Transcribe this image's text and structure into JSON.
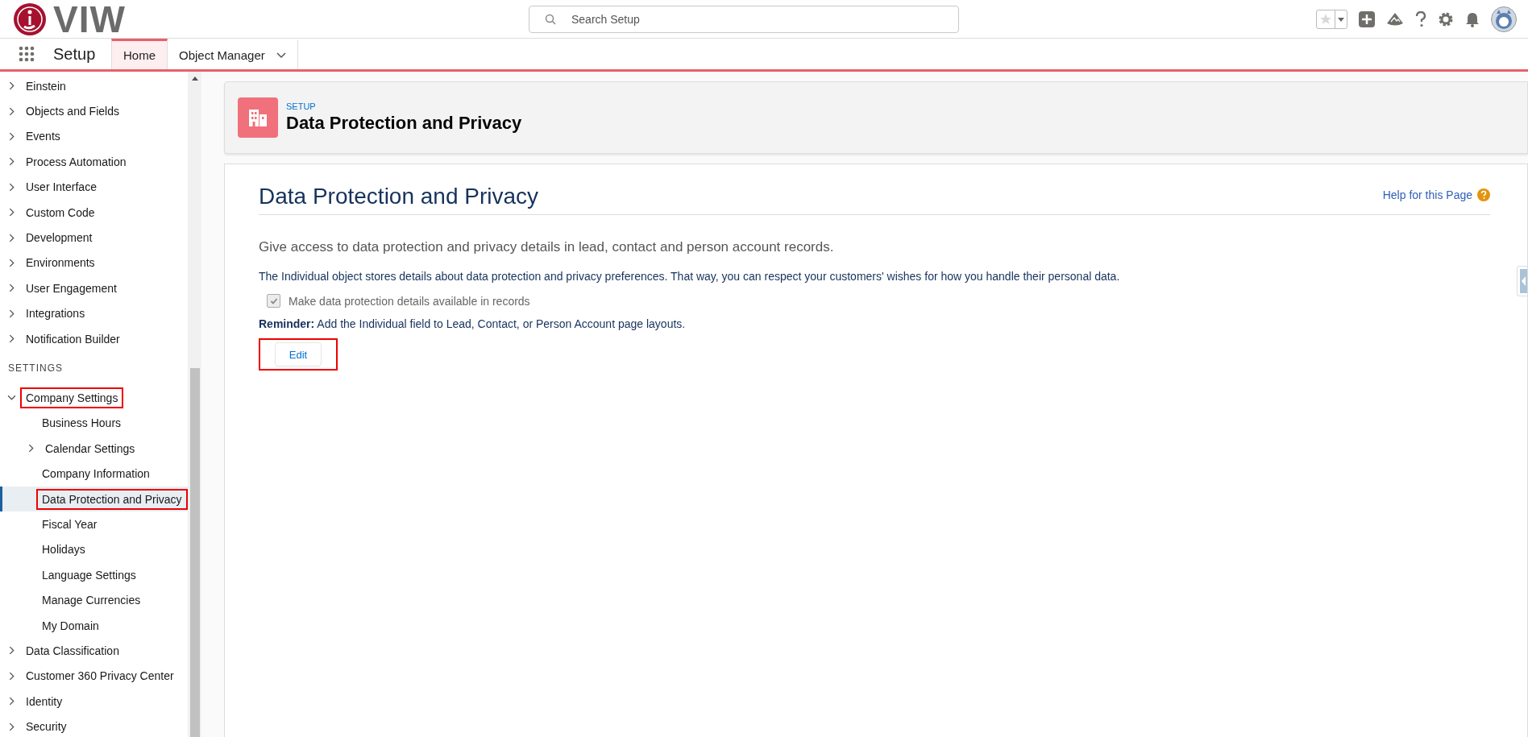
{
  "header": {
    "logo_text": "VIW",
    "search": {
      "placeholder": "Search Setup"
    }
  },
  "nav": {
    "app_name": "Setup",
    "tabs": [
      {
        "label": "Home",
        "selected": true,
        "dropdown": false
      },
      {
        "label": "Object Manager",
        "selected": false,
        "dropdown": true
      }
    ]
  },
  "sidebar": {
    "sections": [
      {
        "items": [
          {
            "label": "Einstein",
            "expanded": false,
            "selected": false,
            "highlighted": false
          },
          {
            "label": "Objects and Fields",
            "expanded": false,
            "selected": false,
            "highlighted": false
          },
          {
            "label": "Events",
            "expanded": false,
            "selected": false,
            "highlighted": false
          },
          {
            "label": "Process Automation",
            "expanded": false,
            "selected": false,
            "highlighted": false
          },
          {
            "label": "User Interface",
            "expanded": false,
            "selected": false,
            "highlighted": false
          },
          {
            "label": "Custom Code",
            "expanded": false,
            "selected": false,
            "highlighted": false
          },
          {
            "label": "Development",
            "expanded": false,
            "selected": false,
            "highlighted": false
          },
          {
            "label": "Environments",
            "expanded": false,
            "selected": false,
            "highlighted": false
          },
          {
            "label": "User Engagement",
            "expanded": false,
            "selected": false,
            "highlighted": false
          },
          {
            "label": "Integrations",
            "expanded": false,
            "selected": false,
            "highlighted": false
          },
          {
            "label": "Notification Builder",
            "expanded": false,
            "selected": false,
            "highlighted": false
          }
        ]
      },
      {
        "heading": "SETTINGS",
        "items": [
          {
            "label": "Company Settings",
            "expanded": true,
            "selected": false,
            "highlighted": true,
            "children": [
              {
                "label": "Business Hours",
                "selected": false,
                "highlighted": false
              },
              {
                "label": "Calendar Settings",
                "expanded": false,
                "selected": false,
                "highlighted": false
              },
              {
                "label": "Company Information",
                "selected": false,
                "highlighted": false
              },
              {
                "label": "Data Protection and Privacy",
                "selected": true,
                "highlighted": true
              },
              {
                "label": "Fiscal Year",
                "selected": false,
                "highlighted": false
              },
              {
                "label": "Holidays",
                "selected": false,
                "highlighted": false
              },
              {
                "label": "Language Settings",
                "selected": false,
                "highlighted": false
              },
              {
                "label": "Manage Currencies",
                "selected": false,
                "highlighted": false
              },
              {
                "label": "My Domain",
                "selected": false,
                "highlighted": false
              }
            ]
          },
          {
            "label": "Data Classification",
            "expanded": false,
            "selected": false,
            "highlighted": false
          },
          {
            "label": "Customer 360 Privacy Center",
            "expanded": false,
            "selected": false,
            "highlighted": false
          },
          {
            "label": "Identity",
            "expanded": false,
            "selected": false,
            "highlighted": false
          },
          {
            "label": "Security",
            "expanded": false,
            "selected": false,
            "highlighted": false
          }
        ]
      }
    ]
  },
  "page_header": {
    "eyebrow": "SETUP",
    "title": "Data Protection and Privacy"
  },
  "content": {
    "title": "Data Protection and Privacy",
    "help_link": "Help for this Page",
    "intro": "Give access to data protection and privacy details in lead, contact and person account records.",
    "description": "The Individual object stores details about data protection and privacy preferences. That way, you can respect your customers' wishes for how you handle their personal data.",
    "checkbox": {
      "label": "Make data protection details available in records",
      "checked": true,
      "disabled": true
    },
    "reminder": "**Reminder:** Add the Individual field to Lead, Contact, or Person Account page layouts.",
    "edit_button": {
      "label": "Edit",
      "highlighted": true
    }
  }
}
